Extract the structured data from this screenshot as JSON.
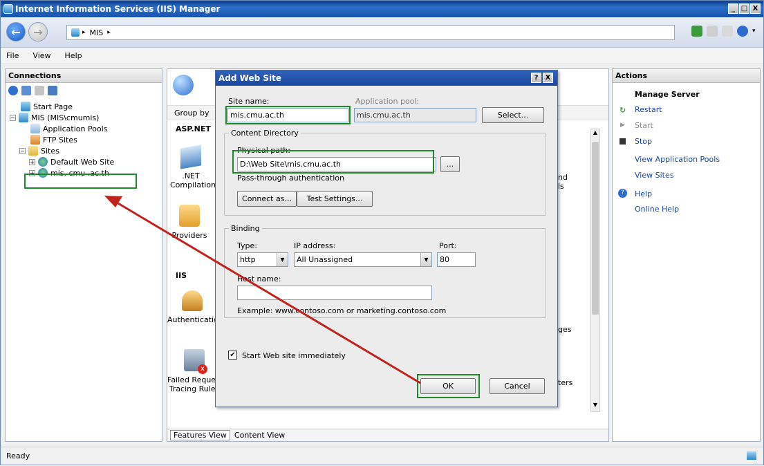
{
  "window": {
    "title": "Internet Information Services (IIS) Manager",
    "caption_buttons": [
      "_",
      "□",
      "X"
    ]
  },
  "address": {
    "breadcrumb": [
      "MIS",
      "▸"
    ]
  },
  "menu": [
    "File",
    "View",
    "Help"
  ],
  "connections": {
    "title": "Connections",
    "tree": [
      {
        "label": "Start Page"
      },
      {
        "label": "MIS (MIS\\cmumis)"
      },
      {
        "label": "Application Pools"
      },
      {
        "label": "FTP Sites"
      },
      {
        "label": "Sites"
      },
      {
        "label": "Default Web Site"
      },
      {
        "label": "mis. cmu .ac.th"
      }
    ]
  },
  "center": {
    "group_by_label": "Group by",
    "sections": [
      "ASP.NET",
      "IIS"
    ],
    "tiles": [
      {
        "label": ".NET\nCompilation"
      },
      {
        "label": "Providers"
      },
      {
        "label": "Authentication"
      },
      {
        "label": "Failed Request\nTracing Rules"
      }
    ],
    "right_tiles": [
      "nd\nls",
      "ges",
      "ters"
    ],
    "view_tabs": [
      "Features View",
      "Content View"
    ]
  },
  "actions": {
    "title": "Actions",
    "manage_server": "Manage Server",
    "restart": "Restart",
    "start": "Start",
    "stop": "Stop",
    "view_app_pools": "View Application Pools",
    "view_sites": "View Sites",
    "help": "Help",
    "online_help": "Online Help"
  },
  "status": {
    "text": "Ready"
  },
  "dialog": {
    "title": "Add Web Site",
    "title_buttons": [
      "?",
      "X"
    ],
    "site_name_label": "Site name:",
    "site_name_value": "mis.cmu.ac.th",
    "app_pool_label": "Application pool:",
    "app_pool_value": "mis.cmu.ac.th",
    "select_button": "Select...",
    "content_dir_label": "Content Directory",
    "physical_path_label": "Physical path:",
    "physical_path_value": "D:\\Web Site\\mis.cmu.ac.th",
    "browse_button": "...",
    "passthrough_label": "Pass-through authentication",
    "connect_as_button": "Connect as...",
    "test_settings_button": "Test Settings...",
    "binding_label": "Binding",
    "type_label": "Type:",
    "type_value": "http",
    "ip_label": "IP address:",
    "ip_value": "All Unassigned",
    "port_label": "Port:",
    "port_value": "80",
    "host_label": "Host name:",
    "host_value": "",
    "example_text": "Example: www.contoso.com or marketing.contoso.com",
    "start_immediately_label": "Start Web site immediately",
    "start_immediately_checked": true,
    "ok_button": "OK",
    "cancel_button": "Cancel"
  },
  "colors": {
    "highlight_green": "#1e8a2e",
    "arrow_red": "#c0221c",
    "title_blue": "#1a48a0"
  }
}
